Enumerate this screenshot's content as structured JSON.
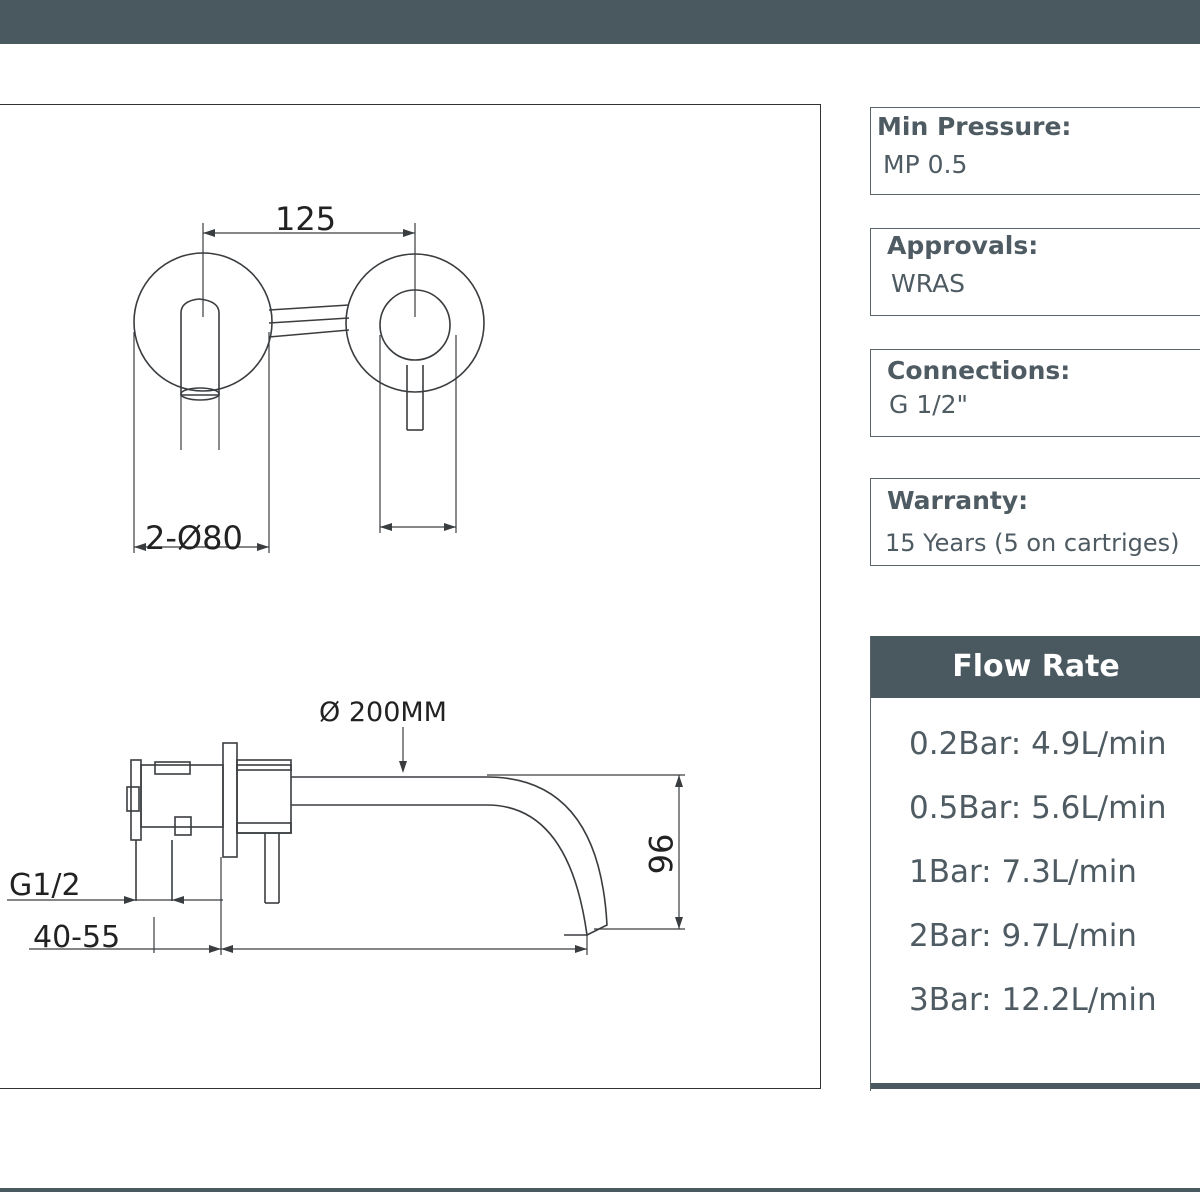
{
  "drawing": {
    "dims": {
      "width_top": "125",
      "plate_dia": "2-Ø80",
      "spout_dia": "Ø 200MM",
      "height": "96",
      "connection": "G1/2",
      "depth": "40-55"
    }
  },
  "specs": [
    {
      "label": "Min Pressure:",
      "value": "MP 0.5"
    },
    {
      "label": "Approvals:",
      "value": "WRAS"
    },
    {
      "label": "Connections:",
      "value": "G 1/2\""
    },
    {
      "label": "Warranty:",
      "value": "15 Years (5 on cartriges)"
    }
  ],
  "flow_rate": {
    "title": "Flow Rate",
    "rows": [
      "0.2Bar:  4.9L/min",
      "0.5Bar:  5.6L/min",
      "1Bar:  7.3L/min",
      "2Bar:  9.7L/min",
      "3Bar:  12.2L/min"
    ]
  },
  "colors": {
    "bar": "#4a5860",
    "text": "#4f5b62",
    "line": "#2e3235"
  }
}
